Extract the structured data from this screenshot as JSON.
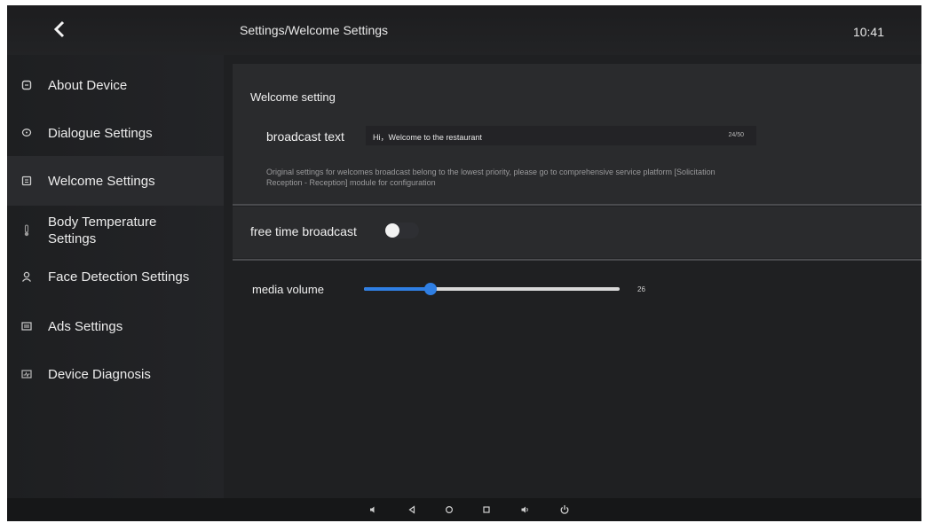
{
  "header": {
    "breadcrumb": "Settings/Welcome Settings",
    "time": "10:41"
  },
  "sidebar": {
    "items": [
      {
        "label": "About Device",
        "icon": "device-icon",
        "active": false
      },
      {
        "label": "Dialogue Settings",
        "icon": "dialogue-icon",
        "active": false
      },
      {
        "label": "Welcome Settings",
        "icon": "welcome-icon",
        "active": true
      },
      {
        "label": "Body Temperature Settings",
        "icon": "thermometer-icon",
        "active": false
      },
      {
        "label": "Face Detection Settings",
        "icon": "face-icon",
        "active": false
      },
      {
        "label": "Ads Settings",
        "icon": "ads-icon",
        "active": false
      },
      {
        "label": "Device Diagnosis",
        "icon": "diagnosis-icon",
        "active": false
      }
    ]
  },
  "welcome": {
    "section_title": "Welcome setting",
    "broadcast_label": "broadcast text",
    "broadcast_value": "Hi，Welcome to the restaurant",
    "char_count": "24/50",
    "note_line1": "Original settings for welcomes broadcast belong to the lowest priority, please go to comprehensive service platform [Solicitation",
    "note_line2": "Reception - Reception] module for configuration"
  },
  "free_time": {
    "label": "free time broadcast",
    "enabled": false
  },
  "media": {
    "label": "media volume",
    "value": "26",
    "level_percent": 26
  },
  "colors": {
    "accent": "#2f7fe4",
    "background": "#1f2022"
  },
  "navbar": {
    "icons": [
      "volume-down-icon",
      "back-icon",
      "home-icon",
      "recents-icon",
      "volume-up-icon",
      "power-icon"
    ]
  }
}
